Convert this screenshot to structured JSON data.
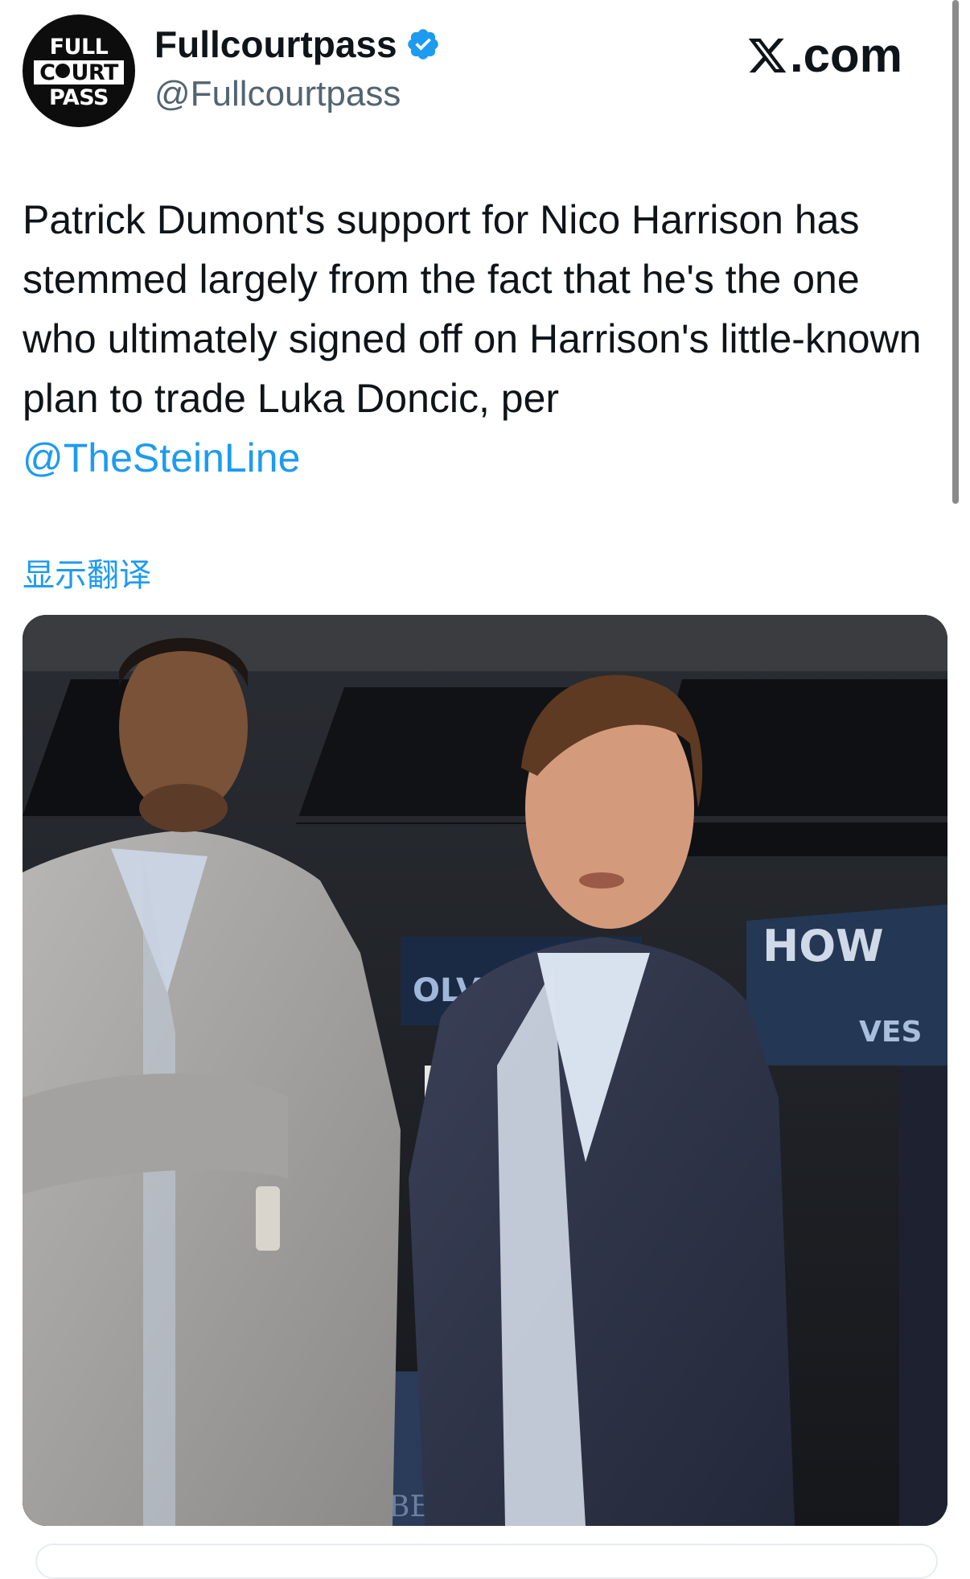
{
  "account": {
    "display_name": "Fullcourtpass",
    "handle": "@Fullcourtpass",
    "verified": true,
    "avatar_logo": {
      "line1": "FULL",
      "line2_prefix": "C",
      "line2_suffix": "URT",
      "line3": "PASS"
    }
  },
  "platform": {
    "site_label": "X.com",
    "site_suffix": ".com",
    "logo_icon": "x-logo-icon"
  },
  "tweet": {
    "text": "Patrick Dumont's support for Nico Harrison has stemmed largely from the fact that he's the one who ultimately signed off on Harrison's little-known plan to trade Luka Doncic, per",
    "mention": "@TheSteinLine",
    "translate_label": "显示翻译"
  },
  "photo": {
    "banner_text_left": "OLVES",
    "banner_text_right": "VES",
    "banner_text_top": "HOW",
    "court_text": "BER"
  },
  "colors": {
    "link": "#1d9bf0",
    "verified": "#1d9bf0",
    "handle": "#536471",
    "text": "#0f1419"
  }
}
